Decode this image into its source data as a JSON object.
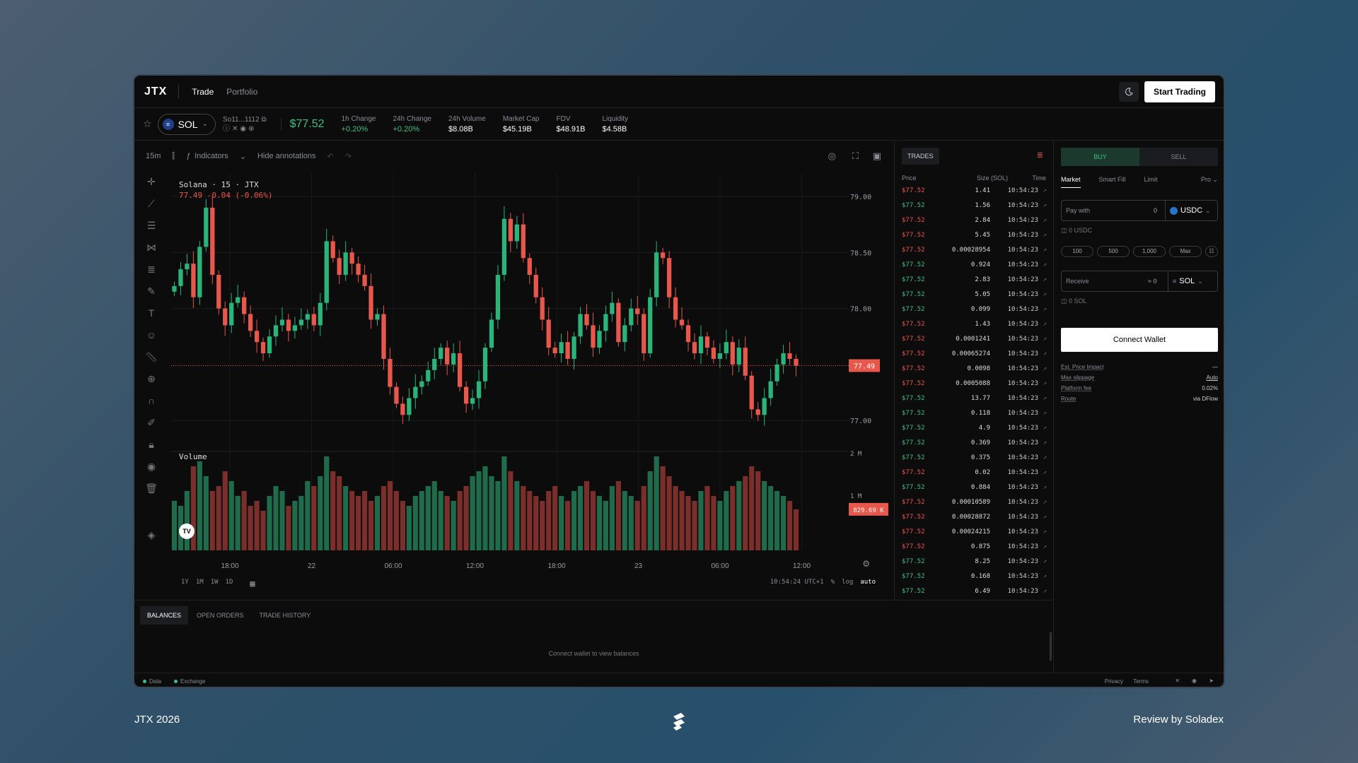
{
  "app": {
    "logo": "JTX",
    "nav": [
      "Trade",
      "Portfolio"
    ],
    "start_trading": "Start Trading"
  },
  "ticker": {
    "symbol": "SOL",
    "address": "So11...1112",
    "price": "$77.52",
    "stats": [
      {
        "label": "1h Change",
        "value": "+0.20%",
        "positive": true
      },
      {
        "label": "24h Change",
        "value": "+0.20%",
        "positive": true
      },
      {
        "label": "24h Volume",
        "value": "$8.08B"
      },
      {
        "label": "Market Cap",
        "value": "$45.19B"
      },
      {
        "label": "FDV",
        "value": "$48.91B"
      },
      {
        "label": "Liquidity",
        "value": "$4.58B"
      }
    ]
  },
  "chart_toolbar": {
    "interval": "15m",
    "indicators": "Indicators",
    "hide_annotations": "Hide annotations"
  },
  "chart_legend": {
    "title": "Solana · 15 · JTX",
    "ohlc": "77.49 -0.04 (-0.06%)",
    "volume_label": "Volume"
  },
  "chart_data": {
    "type": "candlestick",
    "title": "Solana · 15 · JTX",
    "y_ticks": [
      "79.00",
      "78.50",
      "78.00",
      "77.00"
    ],
    "ylim": [
      76.85,
      79.12
    ],
    "x_ticks": [
      "18:00",
      "22",
      "06:00",
      "12:00",
      "18:00",
      "23",
      "06:00",
      "12:00"
    ],
    "last_price_label": "77.49",
    "last_price": 77.49,
    "volume_ticks": [
      "2 M",
      "1 M"
    ],
    "volume_max": 2000000,
    "last_volume_label": "829.69 K",
    "close": [
      78.2,
      78.35,
      78.4,
      78.1,
      78.55,
      78.9,
      78.3,
      78.0,
      77.85,
      78.05,
      78.1,
      77.95,
      77.8,
      77.7,
      77.6,
      77.75,
      77.85,
      77.9,
      77.8,
      77.85,
      77.9,
      77.95,
      77.85,
      78.05,
      78.6,
      78.45,
      78.3,
      78.5,
      78.4,
      78.3,
      78.2,
      77.9,
      77.95,
      77.55,
      77.3,
      77.15,
      77.05,
      77.2,
      77.3,
      77.35,
      77.45,
      77.55,
      77.65,
      77.5,
      77.6,
      77.3,
      77.15,
      77.2,
      77.35,
      77.65,
      77.9,
      78.3,
      78.8,
      78.6,
      78.75,
      78.45,
      78.3,
      78.1,
      77.9,
      77.65,
      77.6,
      77.7,
      77.55,
      77.75,
      77.95,
      77.85,
      77.65,
      77.8,
      77.95,
      78.05,
      77.7,
      77.85,
      78.0,
      77.95,
      77.6,
      78.1,
      78.5,
      78.45,
      78.1,
      77.9,
      77.85,
      77.7,
      77.6,
      77.75,
      77.65,
      77.55,
      77.6,
      77.7,
      77.5,
      77.65,
      77.4,
      77.1,
      77.05,
      77.2,
      77.35,
      77.5,
      77.6,
      77.55,
      77.49
    ],
    "volume": [
      1.0,
      0.9,
      1.2,
      1.7,
      1.8,
      1.5,
      1.2,
      1.3,
      1.6,
      1.4,
      1.1,
      1.2,
      0.9,
      1.0,
      0.8,
      1.1,
      1.3,
      1.2,
      0.9,
      1.0,
      1.1,
      1.4,
      1.3,
      1.5,
      1.9,
      1.6,
      1.5,
      1.3,
      1.2,
      1.1,
      1.2,
      1.0,
      1.1,
      1.3,
      1.4,
      1.2,
      1.0,
      0.9,
      1.1,
      1.2,
      1.3,
      1.4,
      1.2,
      1.1,
      1.0,
      1.2,
      1.3,
      1.5,
      1.6,
      1.7,
      1.5,
      1.4,
      1.9,
      1.6,
      1.4,
      1.3,
      1.2,
      1.1,
      1.0,
      1.2,
      1.3,
      1.1,
      1.0,
      1.2,
      1.3,
      1.4,
      1.2,
      1.1,
      1.0,
      1.3,
      1.4,
      1.2,
      1.1,
      1.0,
      1.3,
      1.6,
      1.9,
      1.7,
      1.5,
      1.3,
      1.2,
      1.1,
      1.0,
      1.2,
      1.3,
      1.1,
      1.0,
      1.2,
      1.3,
      1.4,
      1.5,
      1.7,
      1.6,
      1.4,
      1.3,
      1.2,
      1.1,
      1.0,
      0.83
    ]
  },
  "chart_bottom": {
    "ranges": [
      "1Y",
      "1M",
      "1W",
      "1D"
    ],
    "time": "10:54:24 UTC+1",
    "pct": "%",
    "log": "log",
    "auto": "auto"
  },
  "trades": {
    "tab": "TRADES",
    "headers": [
      "Price",
      "Size (SOL)",
      "Time"
    ],
    "rows": [
      {
        "price": "$77.52",
        "size": "1.41",
        "time": "10:54:23",
        "side": "sell"
      },
      {
        "price": "$77.52",
        "size": "1.56",
        "time": "10:54:23",
        "side": "buy"
      },
      {
        "price": "$77.52",
        "size": "2.84",
        "time": "10:54:23",
        "side": "sell"
      },
      {
        "price": "$77.52",
        "size": "5.45",
        "time": "10:54:23",
        "side": "sell"
      },
      {
        "price": "$77.52",
        "size": "0.00028954",
        "time": "10:54:23",
        "side": "sell"
      },
      {
        "price": "$77.52",
        "size": "0.924",
        "time": "10:54:23",
        "side": "buy"
      },
      {
        "price": "$77.52",
        "size": "2.83",
        "time": "10:54:23",
        "side": "buy"
      },
      {
        "price": "$77.52",
        "size": "5.05",
        "time": "10:54:23",
        "side": "buy"
      },
      {
        "price": "$77.52",
        "size": "0.099",
        "time": "10:54:23",
        "side": "buy"
      },
      {
        "price": "$77.52",
        "size": "1.43",
        "time": "10:54:23",
        "side": "sell"
      },
      {
        "price": "$77.52",
        "size": "0.0001241",
        "time": "10:54:23",
        "side": "sell"
      },
      {
        "price": "$77.52",
        "size": "0.00065274",
        "time": "10:54:23",
        "side": "sell"
      },
      {
        "price": "$77.52",
        "size": "0.0098",
        "time": "10:54:23",
        "side": "sell"
      },
      {
        "price": "$77.52",
        "size": "0.0005088",
        "time": "10:54:23",
        "side": "sell"
      },
      {
        "price": "$77.52",
        "size": "13.77",
        "time": "10:54:23",
        "side": "buy"
      },
      {
        "price": "$77.52",
        "size": "0.118",
        "time": "10:54:23",
        "side": "buy"
      },
      {
        "price": "$77.52",
        "size": "4.9",
        "time": "10:54:23",
        "side": "buy"
      },
      {
        "price": "$77.52",
        "size": "0.369",
        "time": "10:54:23",
        "side": "buy"
      },
      {
        "price": "$77.52",
        "size": "0.375",
        "time": "10:54:23",
        "side": "buy"
      },
      {
        "price": "$77.52",
        "size": "0.02",
        "time": "10:54:23",
        "side": "sell"
      },
      {
        "price": "$77.52",
        "size": "0.884",
        "time": "10:54:23",
        "side": "buy"
      },
      {
        "price": "$77.52",
        "size": "0.00010589",
        "time": "10:54:23",
        "side": "sell"
      },
      {
        "price": "$77.52",
        "size": "0.00028872",
        "time": "10:54:23",
        "side": "sell"
      },
      {
        "price": "$77.52",
        "size": "0.00024215",
        "time": "10:54:23",
        "side": "sell"
      },
      {
        "price": "$77.52",
        "size": "0.875",
        "time": "10:54:23",
        "side": "sell"
      },
      {
        "price": "$77.52",
        "size": "8.25",
        "time": "10:54:23",
        "side": "buy"
      },
      {
        "price": "$77.52",
        "size": "0.168",
        "time": "10:54:23",
        "side": "buy"
      },
      {
        "price": "$77.52",
        "size": "6.49",
        "time": "10:54:23",
        "side": "buy"
      }
    ]
  },
  "swap": {
    "buy": "BUY",
    "sell": "SELL",
    "order_tabs": [
      "Market",
      "Smart Fill",
      "Limit",
      "Pro"
    ],
    "pay_label": "Pay with",
    "pay_value": "0",
    "pay_token": "USDC",
    "pay_balance": "0 USDC",
    "quick": [
      "100",
      "500",
      "1,000",
      "Max"
    ],
    "receive_label": "Receive",
    "receive_value": "≈ 0",
    "receive_token": "SOL",
    "receive_balance": "0 SOL",
    "connect": "Connect Wallet",
    "info": [
      {
        "label": "Est. Price Impact",
        "value": "—"
      },
      {
        "label": "Max slippage",
        "value": "Auto"
      },
      {
        "label": "Platform fee",
        "value": "0.02%"
      },
      {
        "label": "Route",
        "value": "via DFlow"
      }
    ]
  },
  "bottom": {
    "tabs": [
      "BALANCES",
      "OPEN ORDERS",
      "TRADE HISTORY"
    ],
    "empty": "Connect wallet to view balances"
  },
  "footer": {
    "data": "Data",
    "exchange": "Exchange",
    "privacy": "Privacy",
    "terms": "Terms"
  },
  "outer": {
    "left": "JTX 2026",
    "right": "Review by Soladex"
  },
  "colors": {
    "up": "#2bb37a",
    "down": "#e8574b",
    "bg": "#0c0c0d"
  }
}
